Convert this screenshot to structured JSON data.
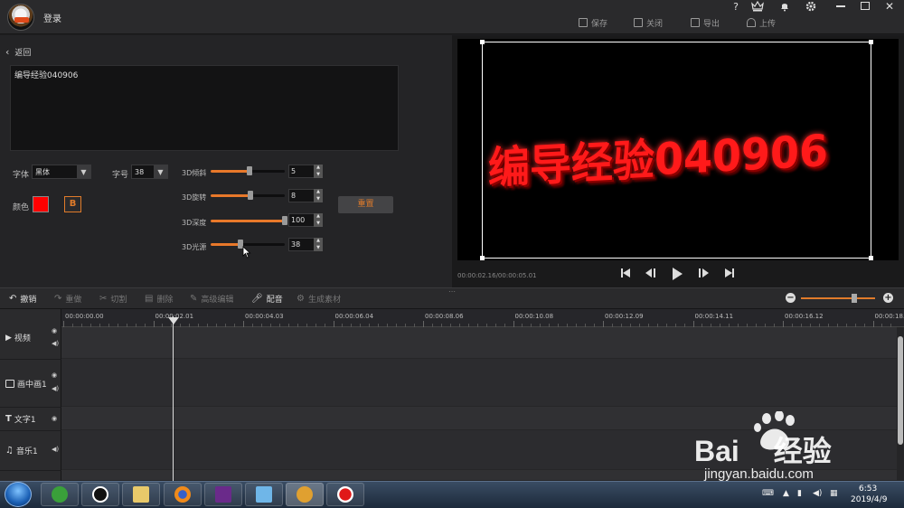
{
  "header": {
    "login": "登录",
    "top_icons": [
      "?",
      "VIP",
      "bell",
      "gear",
      "minimize",
      "restore",
      "close"
    ],
    "actions": [
      {
        "label": "保存",
        "icon": "save-icon"
      },
      {
        "label": "关闭",
        "icon": "exit-icon"
      },
      {
        "label": "导出",
        "icon": "export-icon"
      },
      {
        "label": "上传",
        "icon": "upload-icon"
      }
    ]
  },
  "editor": {
    "back": "返回",
    "text_value": "编导经验040906",
    "font_label": "字体",
    "font_value": "黑体",
    "size_label": "字号",
    "size_value": "38",
    "color_label": "颜色",
    "color_value": "#ff0000",
    "bold_label": "B",
    "reset_label": "重置",
    "sliders": [
      {
        "label": "3D倾斜",
        "value": "5",
        "fraction": 0.53
      },
      {
        "label": "3D旋转",
        "value": "8",
        "fraction": 0.54
      },
      {
        "label": "3D深度",
        "value": "100",
        "fraction": 1.0
      },
      {
        "label": "3D光源",
        "value": "38",
        "fraction": 0.4
      }
    ]
  },
  "preview": {
    "text": "编导经验040906",
    "text_color": "#ff1a1a",
    "time": "00:00:02.16/00:00:05.01"
  },
  "toolbar": {
    "tools": [
      {
        "label": "撤销",
        "icon": "undo-icon"
      },
      {
        "label": "重做",
        "icon": "redo-icon"
      },
      {
        "label": "切割",
        "icon": "scissors-icon"
      },
      {
        "label": "删除",
        "icon": "trash-icon"
      },
      {
        "label": "高级编辑",
        "icon": "pencil-icon"
      },
      {
        "label": "配音",
        "icon": "microphone-icon"
      },
      {
        "label": "生成素材",
        "icon": "gear-icon"
      }
    ],
    "zoom_fraction": 0.72
  },
  "timeline": {
    "ticks": [
      "00:00:00.00",
      "00:00:02.01",
      "00:00:04.03",
      "00:00:06.04",
      "00:00:08.06",
      "00:00:10.08",
      "00:00:12.09",
      "00:00:14.11",
      "00:00:16.12",
      "00:00:18."
    ],
    "tracks": [
      {
        "label": "视频",
        "icon": "video-icon"
      },
      {
        "label": "画中画1",
        "icon": "pip-icon"
      },
      {
        "label": "文字1",
        "icon": "text-icon"
      },
      {
        "label": "音乐1",
        "icon": "music-icon"
      }
    ]
  },
  "taskbar": {
    "time": "6:53",
    "date": "2019/4/9"
  },
  "watermark": {
    "brand": "Bai",
    "brand2": "经验",
    "url": "jingyan.baidu.com"
  }
}
